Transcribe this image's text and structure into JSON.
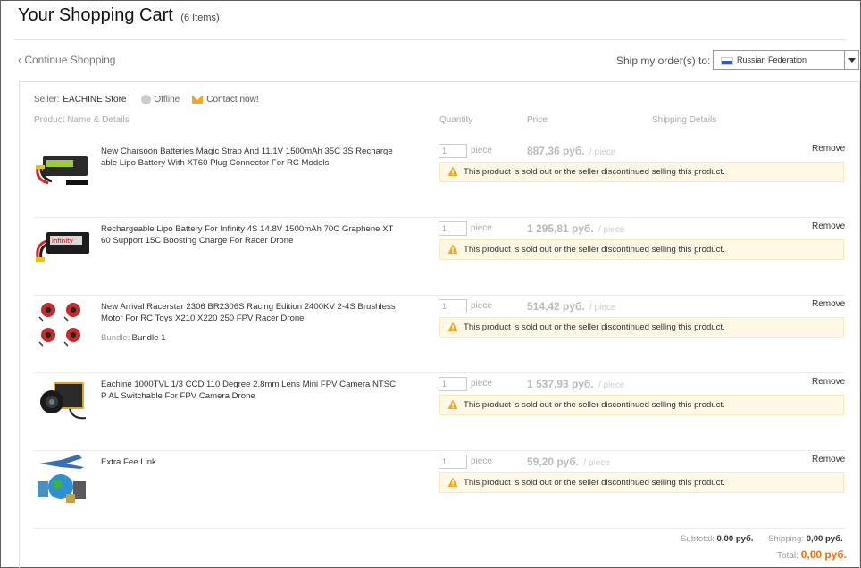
{
  "header": {
    "title": "Your Shopping Cart",
    "count": "(6 Items)"
  },
  "nav": {
    "continue": "‹ Continue Shopping"
  },
  "shipping": {
    "label": "Ship my order(s) to:",
    "country": "Russian Federation"
  },
  "seller": {
    "label": "Seller:",
    "name": "EACHINE Store",
    "status": "Offline",
    "contact": "Contact now!"
  },
  "columns": {
    "product": "Product Name & Details",
    "quantity": "Quantity",
    "price": "Price",
    "shipping": "Shipping Details"
  },
  "items": [
    {
      "name": "New Charsoon Batteries Magic Strap And 11.1V 1500mAh 35C 3S Recharge able Lipo Battery With XT60 Plug Connector For RC Models",
      "qty": "1",
      "unit": "piece",
      "price": "887,36 руб.",
      "price_unit": "/ piece",
      "remove": "Remove",
      "warning": "This product is sold out or the seller discontinued selling this product.",
      "bundle_label": "",
      "bundle_value": ""
    },
    {
      "name": "Rechargeable Lipo Battery For Infinity 4S 14.8V 1500mAh 70C Graphene XT 60 Support 15C Boosting Charge For Racer Drone",
      "qty": "1",
      "unit": "piece",
      "price": "1 295,81 руб.",
      "price_unit": "/ piece",
      "remove": "Remove",
      "warning": "This product is sold out or the seller discontinued selling this product.",
      "bundle_label": "",
      "bundle_value": ""
    },
    {
      "name": "New Arrival Racerstar 2306 BR2306S Racing Edition 2400KV 2-4S Brushless Motor For RC Toys X210 X220 250 FPV Racer Drone",
      "qty": "1",
      "unit": "piece",
      "price": "514,42 руб.",
      "price_unit": "/ piece",
      "remove": "Remove",
      "warning": "This product is sold out or the seller discontinued selling this product.",
      "bundle_label": "Bundle:",
      "bundle_value": "Bundle 1"
    },
    {
      "name": "Eachine 1000TVL 1/3 CCD 110 Degree 2.8mm Lens Mini FPV Camera NTSC P AL Switchable For FPV Camera Drone",
      "qty": "1",
      "unit": "piece",
      "price": "1 537,93 руб.",
      "price_unit": "/ piece",
      "remove": "Remove",
      "warning": "This product is sold out or the seller discontinued selling this product.",
      "bundle_label": "",
      "bundle_value": ""
    },
    {
      "name": "Extra Fee Link",
      "qty": "1",
      "unit": "piece",
      "price": "59,20 руб.",
      "price_unit": "/ piece",
      "remove": "Remove",
      "warning": "This product is sold out or the seller discontinued selling this product.",
      "bundle_label": "",
      "bundle_value": ""
    }
  ],
  "summary": {
    "subtotal_label": "Subtotal:",
    "subtotal": "0,00 руб.",
    "shipping_label": "Shipping:",
    "shipping": "0,00 руб.",
    "total_label": "Total:",
    "total": "0,00 руб."
  },
  "colors": {
    "accent": "#ff6a00",
    "warning_bg": "#fff8e6",
    "warning_icon": "#f5a623"
  },
  "icons": {
    "flag": "russia-flag-icon",
    "status": "offline-icon",
    "contact": "mail-icon",
    "warning": "warning-icon",
    "dropdown": "chevron-down-icon"
  }
}
